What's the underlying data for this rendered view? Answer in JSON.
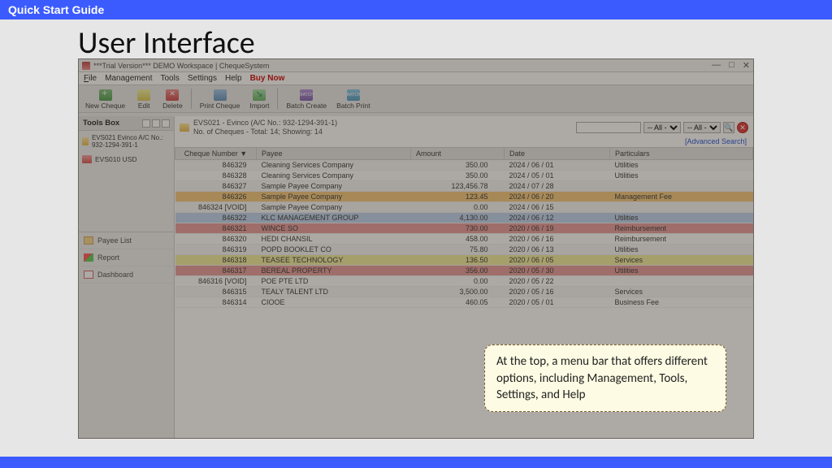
{
  "banner": {
    "title": "Quick Start Guide"
  },
  "heading": "User Interface",
  "callout": "At the top, a menu bar that offers different options, including Management, Tools, Settings, and Help",
  "window": {
    "title": "***Trial Version*** DEMO Workspace | ChequeSystem",
    "min": "—",
    "max": "□",
    "close": "✕"
  },
  "menu": {
    "file": "File",
    "management": "Management",
    "tools": "Tools",
    "settings": "Settings",
    "help": "Help",
    "buy": "Buy Now"
  },
  "toolbar": {
    "new": "New Cheque",
    "edit": "Edit",
    "delete": "Delete",
    "print": "Print Cheque",
    "import": "Import",
    "batch_create": "Batch Create",
    "batch_print": "Batch Print"
  },
  "sidebar": {
    "header": "Tools Box",
    "acc1": "EVS021 Evinco A/C No.: 932-1294-391-1",
    "acc2": "EVS010 USD",
    "items": [
      {
        "label": "Payee List",
        "ic": "payee"
      },
      {
        "label": "Report",
        "ic": "report"
      },
      {
        "label": "Dashboard",
        "ic": "dash"
      }
    ]
  },
  "crumb": {
    "line1": "EVS021 - Evinco (A/C No.: 932-1294-391-1)",
    "line2": "No. of Cheques - Total: 14; Showing: 14",
    "filter_all": "-- All --",
    "advanced": "[Advanced Search]"
  },
  "table": {
    "headers": {
      "num": "Cheque Number ▼",
      "payee": "Payee",
      "amount": "Amount",
      "date": "Date",
      "part": "Particulars"
    },
    "rows": [
      {
        "n": "846329",
        "p": "Cleaning Services Company",
        "a": "350.00",
        "d": "2024 / 06 / 01",
        "pa": "Utilities",
        "c": ""
      },
      {
        "n": "846328",
        "p": "Cleaning Services Company",
        "a": "350.00",
        "d": "2024 / 05 / 01",
        "pa": "Utilities",
        "c": ""
      },
      {
        "n": "846327",
        "p": "Sample Payee Company",
        "a": "123,456.78",
        "d": "2024 / 07 / 28",
        "pa": "",
        "c": ""
      },
      {
        "n": "846326",
        "p": "Sample Payee Company",
        "a": "123.45",
        "d": "2024 / 06 / 20",
        "pa": "Management Fee",
        "c": "hl-orange"
      },
      {
        "n": "846324 [VOID]",
        "p": "Sample Payee Company",
        "a": "0.00",
        "d": "2024 / 06 / 15",
        "pa": "",
        "c": ""
      },
      {
        "n": "846322",
        "p": "KLC MANAGEMENT GROUP",
        "a": "4,130.00",
        "d": "2024 / 06 / 12",
        "pa": "Utilities",
        "c": "hl-blue"
      },
      {
        "n": "846321",
        "p": "WINCE SO",
        "a": "730.00",
        "d": "2020 / 06 / 19",
        "pa": "Reimbursement",
        "c": "hl-red"
      },
      {
        "n": "846320",
        "p": "HEDI CHANSIL",
        "a": "458.00",
        "d": "2020 / 06 / 16",
        "pa": "Reimbursement",
        "c": ""
      },
      {
        "n": "846319",
        "p": "POPD BOOKLET CO",
        "a": "75.80",
        "d": "2020 / 06 / 13",
        "pa": "Utilities",
        "c": ""
      },
      {
        "n": "846318",
        "p": "TEASEE TECHNOLOGY",
        "a": "136.50",
        "d": "2020 / 06 / 05",
        "pa": "Services",
        "c": "hl-yellow"
      },
      {
        "n": "846317",
        "p": "BEREAL PROPERTY",
        "a": "356.00",
        "d": "2020 / 05 / 30",
        "pa": "Utilities",
        "c": "hl-red"
      },
      {
        "n": "846316 [VOID]",
        "p": "POE PTE LTD",
        "a": "0.00",
        "d": "2020 / 05 / 22",
        "pa": "",
        "c": ""
      },
      {
        "n": "846315",
        "p": "TEALY TALENT LTD",
        "a": "3,500.00",
        "d": "2020 / 05 / 16",
        "pa": "Services",
        "c": ""
      },
      {
        "n": "846314",
        "p": "CIOOE",
        "a": "460.05",
        "d": "2020 / 05 / 01",
        "pa": "Business Fee",
        "c": ""
      }
    ]
  }
}
